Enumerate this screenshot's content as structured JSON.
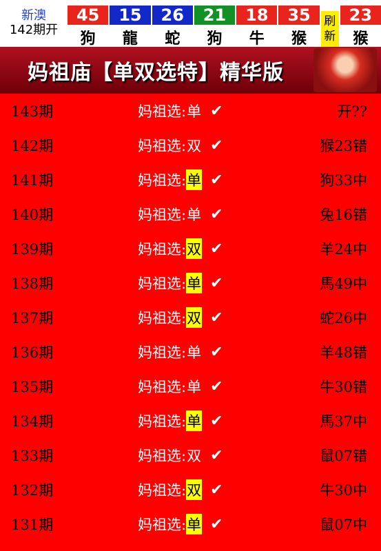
{
  "top": {
    "site": "新澳",
    "period": "142期开",
    "balls": [
      {
        "num": "45",
        "zodiac": "狗",
        "color": "#e8241c"
      },
      {
        "num": "15",
        "zodiac": "龍",
        "color": "#1228c8"
      },
      {
        "num": "26",
        "zodiac": "蛇",
        "color": "#1228c8"
      },
      {
        "num": "21",
        "zodiac": "狗",
        "color": "#139126"
      },
      {
        "num": "18",
        "zodiac": "牛",
        "color": "#e8241c"
      },
      {
        "num": "35",
        "zodiac": "猴",
        "color": "#e8241c"
      }
    ],
    "refresh": [
      "刷",
      "新"
    ],
    "special": {
      "num": "23",
      "zodiac": "猴",
      "color": "#e8241c"
    }
  },
  "banner": {
    "title": "妈祖庙【单双选特】精华版"
  },
  "rows": [
    {
      "period": "143期",
      "label": "妈祖选:",
      "pick": "单",
      "hl": false,
      "check": "✔",
      "result": "开??"
    },
    {
      "period": "142期",
      "label": "妈祖选:",
      "pick": "双",
      "hl": false,
      "check": "✔",
      "result": "猴23错"
    },
    {
      "period": "141期",
      "label": "妈祖选:",
      "pick": "单",
      "hl": true,
      "check": "✔",
      "result": "狗33中"
    },
    {
      "period": "140期",
      "label": "妈祖选:",
      "pick": "单",
      "hl": false,
      "check": "✔",
      "result": "兔16错"
    },
    {
      "period": "139期",
      "label": "妈祖选:",
      "pick": "双",
      "hl": true,
      "check": "✔",
      "result": "羊24中"
    },
    {
      "period": "138期",
      "label": "妈祖选:",
      "pick": "单",
      "hl": true,
      "check": "✔",
      "result": "馬49中"
    },
    {
      "period": "137期",
      "label": "妈祖选:",
      "pick": "双",
      "hl": true,
      "check": "✔",
      "result": "蛇26中"
    },
    {
      "period": "136期",
      "label": "妈祖选:",
      "pick": "单",
      "hl": false,
      "check": "✔",
      "result": "羊48错"
    },
    {
      "period": "135期",
      "label": "妈祖选:",
      "pick": "单",
      "hl": false,
      "check": "✔",
      "result": "牛30错"
    },
    {
      "period": "134期",
      "label": "妈祖选:",
      "pick": "单",
      "hl": true,
      "check": "✔",
      "result": "馬37中"
    },
    {
      "period": "133期",
      "label": "妈祖选:",
      "pick": "双",
      "hl": false,
      "check": "✔",
      "result": "鼠07错"
    },
    {
      "period": "132期",
      "label": "妈祖选:",
      "pick": "双",
      "hl": true,
      "check": "✔",
      "result": "牛30中"
    },
    {
      "period": "131期",
      "label": "妈祖选:",
      "pick": "单",
      "hl": true,
      "check": "✔",
      "result": "鼠07中"
    }
  ]
}
